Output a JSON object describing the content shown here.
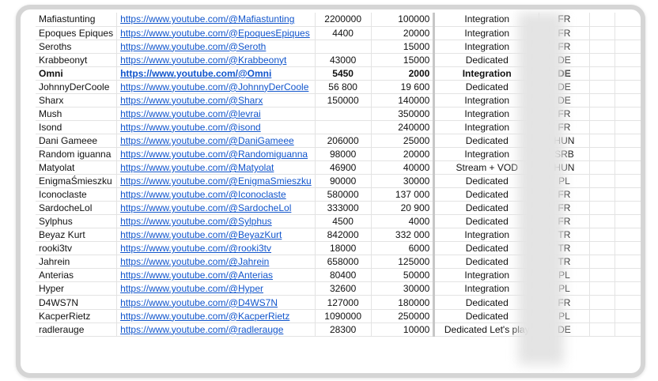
{
  "rows": [
    {
      "name": "Mafiastunting",
      "link": "https://www.youtube.com/@Mafiastunting",
      "link_clip": true,
      "subs": "2200000",
      "views": "100000",
      "type": "Integration",
      "country": "FR"
    },
    {
      "name": "Epoques Epiques",
      "link": "https://www.youtube.com/@EpoquesEpiques",
      "link_clip": true,
      "subs": "4400",
      "views": "20000",
      "type": "Integration",
      "country": "FR"
    },
    {
      "name": "Seroths",
      "link": "https://www.youtube.com/@Seroth",
      "link_clip": false,
      "subs": "",
      "views": "15000",
      "type": "Integration",
      "country": "FR"
    },
    {
      "name": "Krabbeonyt",
      "link": "https://www.youtube.com/@Krabbeonyt",
      "link_clip": true,
      "subs": "43000",
      "views": "15000",
      "type": "Dedicated",
      "country": "DE"
    },
    {
      "name": "Omni",
      "link": "https://www.youtube.com/@Omni",
      "link_clip": true,
      "subs": "5450",
      "views": "2000",
      "type": "Integration",
      "country": "DE",
      "bold": true
    },
    {
      "name": "JohnnyDerCoole",
      "link": "https://www.youtube.com/@JohnnyDerCoole",
      "link_clip": true,
      "subs": "56 800",
      "views": "19 600",
      "type": "Dedicated",
      "country": "DE"
    },
    {
      "name": "Sharx",
      "link": "https://www.youtube.com/@Sharx",
      "link_clip": true,
      "subs": "150000",
      "views": "140000",
      "type": "Integration",
      "country": "DE"
    },
    {
      "name": "Mush",
      "link": "https://www.youtube.com/@levrai",
      "link_clip": false,
      "subs": "",
      "views": "350000",
      "type": "Integration",
      "country": "FR"
    },
    {
      "name": "Isond",
      "link": "https://www.youtube.com/@isond",
      "link_clip": false,
      "subs": "",
      "views": "240000",
      "type": "Integration",
      "country": "FR"
    },
    {
      "name": "Dani Gameee",
      "link": "https://www.youtube.com/@DaniGameee",
      "link_clip": true,
      "subs": "206000",
      "views": "25000",
      "type": "Dedicated",
      "country": "HUN"
    },
    {
      "name": "Random iguanna",
      "link": "https://www.youtube.com/@Randomiguanna",
      "link_clip": true,
      "subs": "98000",
      "views": "20000",
      "type": "Integration",
      "country": "SRB"
    },
    {
      "name": "Matyolat",
      "link": "https://www.youtube.com/@Matyolat",
      "link_clip": true,
      "subs": "46900",
      "views": "40000",
      "type": "Stream + VOD",
      "country": "HUN"
    },
    {
      "name": "EnigmaŚmieszku",
      "link": "https://www.youtube.com/@EnigmaSmieszku",
      "link_clip": true,
      "subs": "90000",
      "views": "30000",
      "type": "Dedicated",
      "country": "PL"
    },
    {
      "name": "Iconoclaste",
      "link": "https://www.youtube.com/@Iconoclaste",
      "link_clip": true,
      "subs": "580000",
      "views": "137 000",
      "type": "Dedicated",
      "country": "FR"
    },
    {
      "name": "SardocheLol",
      "link": "https://www.youtube.com/@SardocheLol",
      "link_clip": true,
      "subs": "333000",
      "views": "20 900",
      "type": "Dedicated",
      "country": "FR"
    },
    {
      "name": "Sylphus",
      "link": "https://www.youtube.com/@Sylphus",
      "link_clip": true,
      "subs": "4500",
      "views": "4000",
      "type": "Dedicated",
      "country": "FR"
    },
    {
      "name": "Beyaz Kurt",
      "link": "https://www.youtube.com/@BeyazKurt",
      "link_clip": true,
      "subs": "842000",
      "views": "332 000",
      "type": "Integration",
      "country": "TR"
    },
    {
      "name": "rooki3tv",
      "link": "https://www.youtube.com/@rooki3tv",
      "link_clip": true,
      "subs": "18000",
      "views": "6000",
      "type": "Dedicated",
      "country": "TR"
    },
    {
      "name": "Jahrein",
      "link": "https://www.youtube.com/@Jahrein",
      "link_clip": true,
      "subs": "658000",
      "views": "125000",
      "type": "Dedicated",
      "country": "TR"
    },
    {
      "name": "Anterias",
      "link": "https://www.youtube.com/@Anterias",
      "link_clip": true,
      "subs": "80400",
      "views": "50000",
      "type": "Integration",
      "country": "PL"
    },
    {
      "name": "Hyper",
      "link": "https://www.youtube.com/@Hyper",
      "link_clip": true,
      "subs": "32600",
      "views": "30000",
      "type": "Integration",
      "country": "PL"
    },
    {
      "name": "D4WS7N",
      "link": "https://www.youtube.com/@D4WS7N",
      "link_clip": true,
      "subs": "127000",
      "views": "180000",
      "type": "Dedicated",
      "country": "FR"
    },
    {
      "name": "KacperRietz",
      "link": "https://www.youtube.com/@KacperRietz",
      "link_clip": true,
      "subs": "1090000",
      "views": "250000",
      "type": "Dedicated",
      "country": "PL"
    },
    {
      "name": "radlerauge",
      "link": "https://www.youtube.com/@radlerauge",
      "link_clip": true,
      "subs": "28300",
      "views": "10000",
      "type": "Dedicated Let's play",
      "country": "DE"
    }
  ],
  "colors": {
    "link": "#1155cc",
    "grid": "#e3e3e3",
    "frame": "#d5d5d5"
  }
}
